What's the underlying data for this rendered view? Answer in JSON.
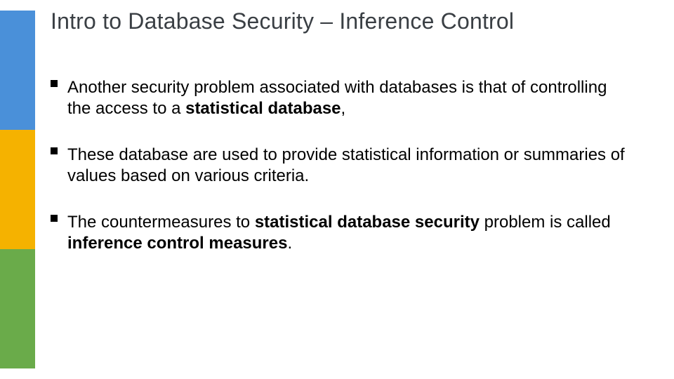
{
  "title": "Intro to Database Security – Inference Control",
  "bullets": [
    {
      "pre": "Another security problem associated with databases is that of controlling the access to a ",
      "bold": "statistical database",
      "post": ","
    },
    {
      "pre": "These database are used to provide statistical information or summaries of values based on various criteria.",
      "bold": "",
      "post": ""
    },
    {
      "pre": "The countermeasures to ",
      "bold": "statistical database security",
      "post_mid": " problem is called ",
      "bold2": "inference control measures",
      "post": "."
    }
  ]
}
